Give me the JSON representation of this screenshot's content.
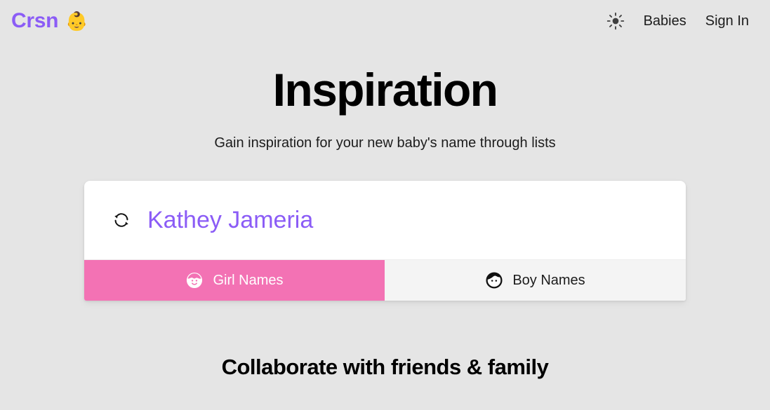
{
  "navbar": {
    "brand": {
      "text": "Crsn",
      "emoji": "👶",
      "emoji_name": "baby-emoji"
    },
    "theme_toggle": {
      "icon": "sun-icon"
    },
    "links": [
      {
        "label": "Babies",
        "name": "nav-link-babies"
      },
      {
        "label": "Sign In",
        "name": "nav-link-sign-in"
      }
    ]
  },
  "hero": {
    "title": "Inspiration",
    "subtitle": "Gain inspiration for your new baby's name through lists"
  },
  "card": {
    "refresh_icon": "refresh-icon",
    "name": "Kathey Jameria",
    "tabs": [
      {
        "label": "Girl Names",
        "icon": "girl-face-icon",
        "active": true
      },
      {
        "label": "Boy Names",
        "icon": "boy-face-icon",
        "active": false
      }
    ]
  },
  "bottom_section": {
    "heading": "Collaborate with friends & family"
  },
  "colors": {
    "background": "#e5e5e5",
    "brand_purple": "#8b5cf6",
    "accent_pink": "#f372b4",
    "card_white": "#ffffff",
    "tab_inactive": "#f4f4f4",
    "text_dark": "#1c1c1c"
  }
}
